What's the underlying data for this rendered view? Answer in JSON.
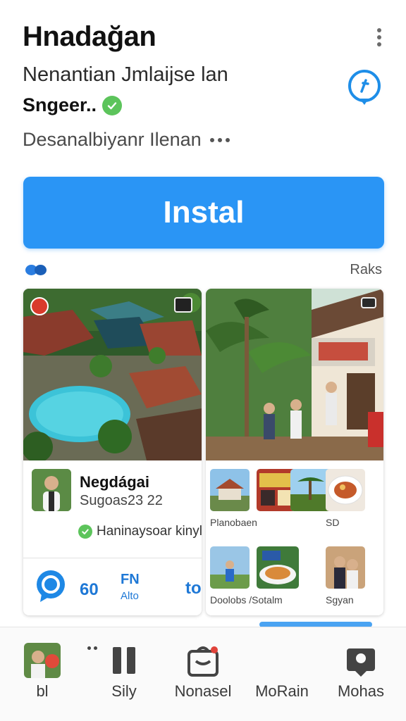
{
  "header": {
    "app_title": "Ηnadağan",
    "subtitle": "Nenantian Jmlaijse lan",
    "status": "Sngeer..",
    "description": "Desanalbiyanr Ilenan"
  },
  "install_button": {
    "label": "Instal"
  },
  "meta": {
    "rank_label": "Raks"
  },
  "card_left": {
    "profile_name": "Negdágai",
    "profile_sub": "Sugoas23 22",
    "verified_text": "Haninaysoar kinyle",
    "stat_count": "60",
    "stat_fn": "FN",
    "stat_sub": "Alto",
    "stat_to": "to"
  },
  "card_right": {
    "thumbs": [
      {
        "label": "Planobaen"
      },
      {
        "label": ""
      },
      {
        "label": "SD"
      },
      {
        "label": "Doolobs /Sotalm"
      },
      {
        "label": ""
      },
      {
        "label": "Sgyan"
      }
    ]
  },
  "bottom_nav": {
    "items": [
      {
        "label": "bl",
        "icon": "profile-photo"
      },
      {
        "label": "Sily",
        "icon": "pause-icon"
      },
      {
        "label": "Nonasel",
        "icon": "bag-icon"
      },
      {
        "label": "MoRain",
        "icon": ""
      },
      {
        "label": "Mohas",
        "icon": "photo-icon"
      }
    ]
  },
  "colors": {
    "accent": "#2a95f5",
    "link_blue": "#1e78d6",
    "check_green": "#5cc45b"
  }
}
